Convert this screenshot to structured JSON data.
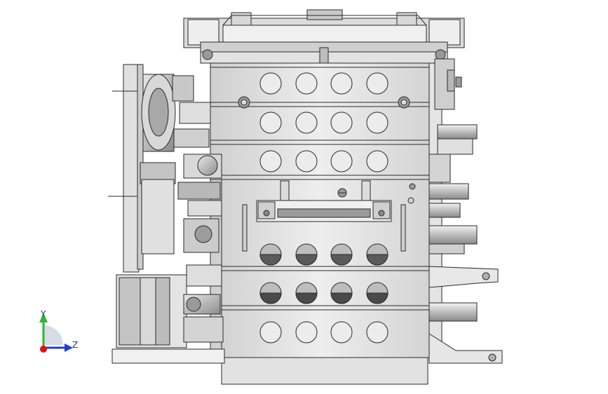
{
  "viewport": {
    "background": "#ffffff"
  },
  "model": {
    "body_color": "#e6e6e6",
    "shade_color": "#b8b8b8",
    "dark_color": "#6a6a6a",
    "edge_color": "#2a2a2a"
  },
  "triad": {
    "y_label": "Y",
    "z_label": "Z",
    "y_color": "#2db82d",
    "z_color": "#2040d0",
    "x_color": "#e01010"
  }
}
